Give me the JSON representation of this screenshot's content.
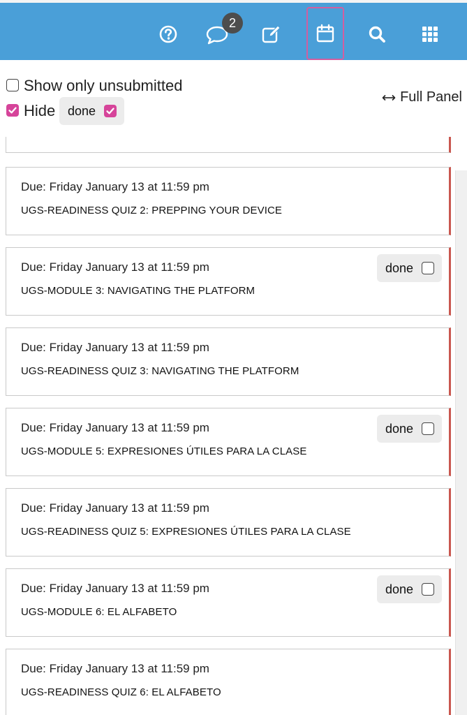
{
  "topbar": {
    "icons": [
      "help-icon",
      "chat-icon",
      "edit-icon",
      "calendar-icon",
      "search-icon",
      "apps-grid-icon"
    ],
    "chat_badge": "2",
    "active_icon": "calendar-icon",
    "color": "#4a9fd8",
    "active_border_color": "#d25fa0"
  },
  "filters": {
    "show_only_unsubmitted": {
      "label": "Show only unsubmitted",
      "checked": false
    },
    "hide": {
      "label": "Hide",
      "checked": true
    },
    "hide_done": {
      "label": "done",
      "checked": true
    },
    "full_panel": {
      "label": "Full Panel",
      "icon": "left-right-arrow-icon"
    },
    "checkbox_color": "#d6449a"
  },
  "assignments": [
    {
      "due": "Due: Friday January 13 at 11:59 pm",
      "name": "UGS-READINESS QUIZ 2: PREPPING YOUR DEVICE",
      "has_done": false
    },
    {
      "due": "Due: Friday January 13 at 11:59 pm",
      "name": "UGS-MODULE 3: NAVIGATING THE PLATFORM",
      "has_done": true,
      "done_label": "done"
    },
    {
      "due": "Due: Friday January 13 at 11:59 pm",
      "name": "UGS-READINESS QUIZ 3: NAVIGATING THE PLATFORM",
      "has_done": false
    },
    {
      "due": "Due: Friday January 13 at 11:59 pm",
      "name": "UGS-MODULE 5: EXPRESIONES ÚTILES PARA LA CLASE",
      "has_done": true,
      "done_label": "done"
    },
    {
      "due": "Due: Friday January 13 at 11:59 pm",
      "name": "UGS-READINESS QUIZ 5: EXPRESIONES ÚTILES PARA LA CLASE",
      "has_done": false
    },
    {
      "due": "Due: Friday January 13 at 11:59 pm",
      "name": "UGS-MODULE 6: EL ALFABETO",
      "has_done": true,
      "done_label": "done"
    },
    {
      "due": "Due: Friday January 13 at 11:59 pm",
      "name": "UGS-READINESS QUIZ 6: EL ALFABETO",
      "has_done": false
    }
  ],
  "card_accent_color": "#c9574f"
}
